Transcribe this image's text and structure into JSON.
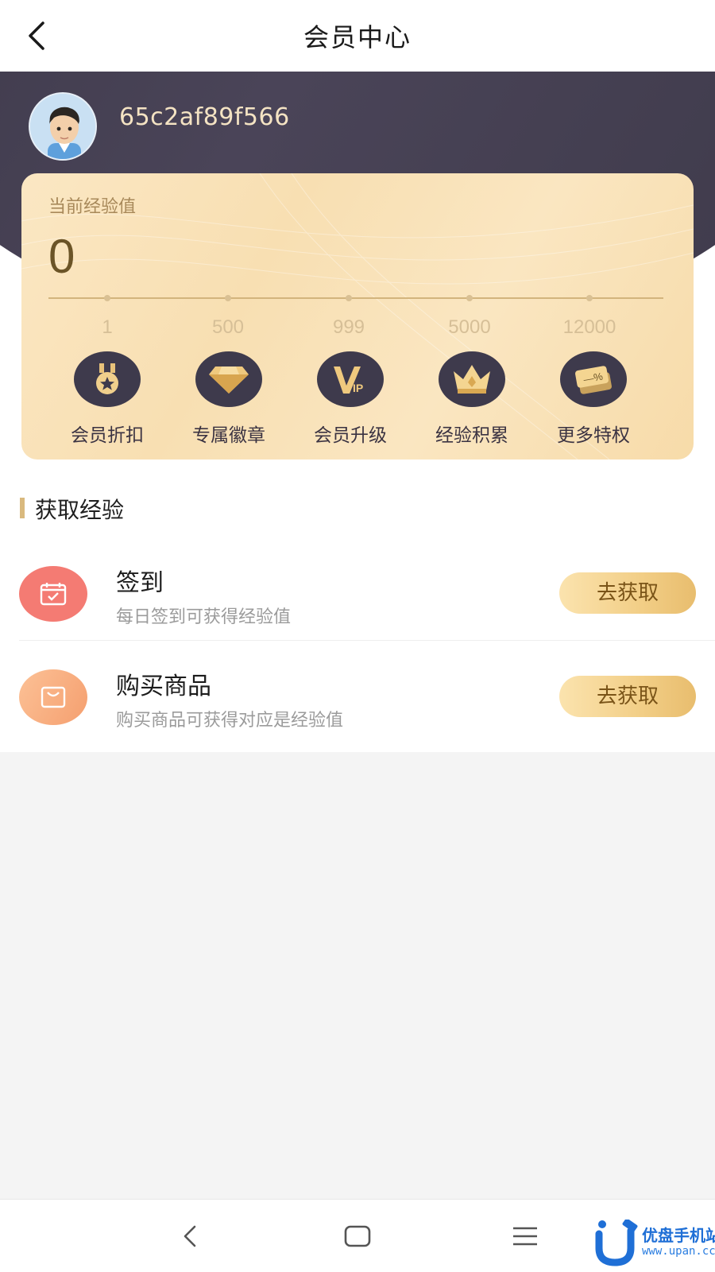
{
  "header": {
    "title": "会员中心"
  },
  "user": {
    "name": "65c2af89f566"
  },
  "experience": {
    "label": "当前经验值",
    "value": "0",
    "milestones": [
      "1",
      "500",
      "999",
      "5000",
      "12000"
    ]
  },
  "perks": [
    {
      "label": "会员折扣",
      "icon": "medal-icon"
    },
    {
      "label": "专属徽章",
      "icon": "diamond-icon"
    },
    {
      "label": "会员升级",
      "icon": "vip-icon"
    },
    {
      "label": "经验积累",
      "icon": "crown-icon"
    },
    {
      "label": "更多特权",
      "icon": "coupon-icon"
    }
  ],
  "section": {
    "title": "获取经验"
  },
  "tasks": [
    {
      "title": "签到",
      "desc": "每日签到可获得经验值",
      "button": "去获取",
      "icon": "calendar-check-icon",
      "color": "#f47b73"
    },
    {
      "title": "购买商品",
      "desc": "购买商品可获得对应是经验值",
      "button": "去获取",
      "icon": "shopping-bag-icon",
      "color": "#f7a875"
    }
  ],
  "watermark": {
    "name": "优盘手机站",
    "url": "www.upan.cc"
  },
  "colors": {
    "gold": "#f2ce86",
    "dark": "#3e3a4c",
    "accent_text": "#f4e3c3"
  }
}
